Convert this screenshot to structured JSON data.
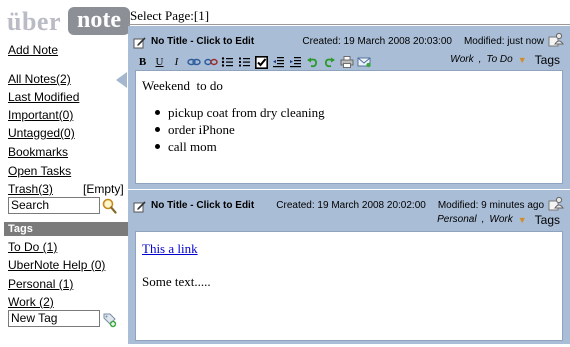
{
  "app": {
    "logo_left": "über",
    "logo_right": "note"
  },
  "sidebar": {
    "add_note": "Add Note",
    "views": {
      "all_notes": "All Notes(2)",
      "last_modified": "Last Modified",
      "important": "Important(0)",
      "untagged": "Untagged(0)",
      "bookmarks": "Bookmarks",
      "open_tasks": "Open Tasks",
      "trash": "Trash(3)",
      "empty": "[Empty]"
    },
    "search": {
      "placeholder": "Search",
      "value": "Search"
    },
    "tags_header": "Tags",
    "tags": {
      "todo": "To Do (1)",
      "help": "UberNote Help (0)",
      "personal": "Personal (1)",
      "work": "Work (2)"
    },
    "new_tag": {
      "placeholder": "New Tag",
      "value": "New Tag"
    }
  },
  "main": {
    "select_page": "Select Page:[1]"
  },
  "toolbar": {
    "bold": "B",
    "underline": "U",
    "italic": "I"
  },
  "notes": [
    {
      "title": "No Title - Click to Edit",
      "created": "Created: 19 March 2008 20:03:00",
      "modified": "Modified: just now",
      "tags": [
        "Work",
        "To Do"
      ],
      "tags_label": "Tags",
      "heading": "Weekend  to do",
      "items": [
        "pickup coat from dry cleaning",
        "order iPhone",
        "call mom"
      ]
    },
    {
      "title": "No Title - Click to Edit",
      "created": "Created: 19 March 2008 20:02:00",
      "modified": "Modified: 9 minutes ago",
      "tags": [
        "Personal",
        "Work"
      ],
      "tags_label": "Tags",
      "link": "This a link",
      "text": "Some text....."
    }
  ],
  "colors": {
    "note_panel": "#a9bdd6",
    "tags_header": "#7b7b7b",
    "logo_note_bg": "#8c8f96",
    "logo_uber": "#b9bcc4",
    "link": "#0000cc"
  },
  "icons": {
    "search": "magnifier-icon",
    "add_tag": "tag-add-icon",
    "edit": "edit-pencil-icon",
    "share": "share-user-icon"
  }
}
